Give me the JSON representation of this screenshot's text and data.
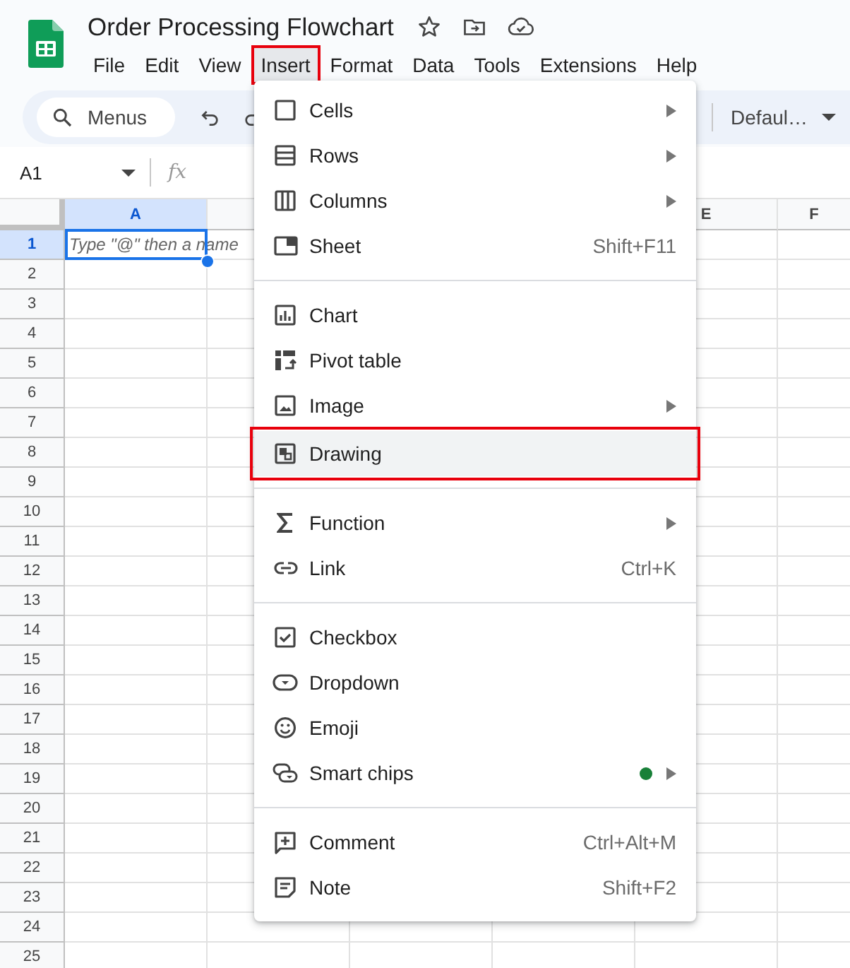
{
  "app": {
    "title": "Order Processing Flowchart",
    "menu": [
      {
        "label": "File",
        "selected": false
      },
      {
        "label": "Edit",
        "selected": false
      },
      {
        "label": "View",
        "selected": false
      },
      {
        "label": "Insert",
        "selected": true
      },
      {
        "label": "Format",
        "selected": false
      },
      {
        "label": "Data",
        "selected": false
      },
      {
        "label": "Tools",
        "selected": false
      },
      {
        "label": "Extensions",
        "selected": false
      },
      {
        "label": "Help",
        "selected": false
      }
    ]
  },
  "toolbar": {
    "search": {
      "placeholder": "Menus"
    },
    "font": "Defaul…"
  },
  "formula_bar": {
    "cell_ref": "A1",
    "function_label": "fx"
  },
  "sheet": {
    "columns": [
      {
        "label": "A",
        "selected": true
      },
      {
        "label": "E",
        "selected": false
      },
      {
        "label": "F",
        "selected": false
      }
    ],
    "rows": [
      {
        "label": "1",
        "selected": true
      },
      {
        "label": "2",
        "selected": false
      },
      {
        "label": "3",
        "selected": false
      },
      {
        "label": "4",
        "selected": false
      },
      {
        "label": "5",
        "selected": false
      },
      {
        "label": "6",
        "selected": false
      },
      {
        "label": "7",
        "selected": false
      },
      {
        "label": "8",
        "selected": false
      },
      {
        "label": "9",
        "selected": false
      },
      {
        "label": "10",
        "selected": false
      },
      {
        "label": "11",
        "selected": false
      },
      {
        "label": "12",
        "selected": false
      },
      {
        "label": "13",
        "selected": false
      },
      {
        "label": "14",
        "selected": false
      },
      {
        "label": "15",
        "selected": false
      },
      {
        "label": "16",
        "selected": false
      },
      {
        "label": "17",
        "selected": false
      },
      {
        "label": "18",
        "selected": false
      },
      {
        "label": "19",
        "selected": false
      },
      {
        "label": "20",
        "selected": false
      },
      {
        "label": "21",
        "selected": false
      },
      {
        "label": "22",
        "selected": false
      },
      {
        "label": "23",
        "selected": false
      },
      {
        "label": "24",
        "selected": false
      },
      {
        "label": "25",
        "selected": false
      }
    ],
    "active_cell_placeholder": "Type \"@\" then a name"
  },
  "insert_menu": {
    "sections": [
      [
        {
          "label": "Cells",
          "kind": "submenu",
          "selected": false,
          "new": false
        },
        {
          "label": "Rows",
          "kind": "submenu",
          "selected": false,
          "new": false
        },
        {
          "label": "Columns",
          "kind": "submenu",
          "selected": false,
          "new": false
        },
        {
          "label": "Sheet",
          "kind": "shortcut",
          "shortcut": "Shift+F11",
          "selected": false,
          "new": false
        }
      ],
      [
        {
          "label": "Chart",
          "kind": "plain",
          "selected": false,
          "new": false
        },
        {
          "label": "Pivot table",
          "kind": "plain",
          "selected": false,
          "new": false
        },
        {
          "label": "Image",
          "kind": "submenu",
          "selected": false,
          "new": false
        },
        {
          "label": "Drawing",
          "kind": "plain",
          "selected": true,
          "new": false
        }
      ],
      [
        {
          "label": "Function",
          "kind": "submenu",
          "selected": false,
          "new": false
        },
        {
          "label": "Link",
          "kind": "shortcut",
          "shortcut": "Ctrl+K",
          "selected": false,
          "new": false
        }
      ],
      [
        {
          "label": "Checkbox",
          "kind": "plain",
          "selected": false,
          "new": false
        },
        {
          "label": "Dropdown",
          "kind": "plain",
          "selected": false,
          "new": false
        },
        {
          "label": "Emoji",
          "kind": "plain",
          "selected": false,
          "new": false
        },
        {
          "label": "Smart chips",
          "kind": "submenu",
          "selected": false,
          "new": true
        }
      ],
      [
        {
          "label": "Comment",
          "kind": "shortcut",
          "shortcut": "Ctrl+Alt+M",
          "selected": false,
          "new": false
        },
        {
          "label": "Note",
          "kind": "shortcut",
          "shortcut": "Shift+F2",
          "selected": false,
          "new": false
        }
      ]
    ]
  }
}
